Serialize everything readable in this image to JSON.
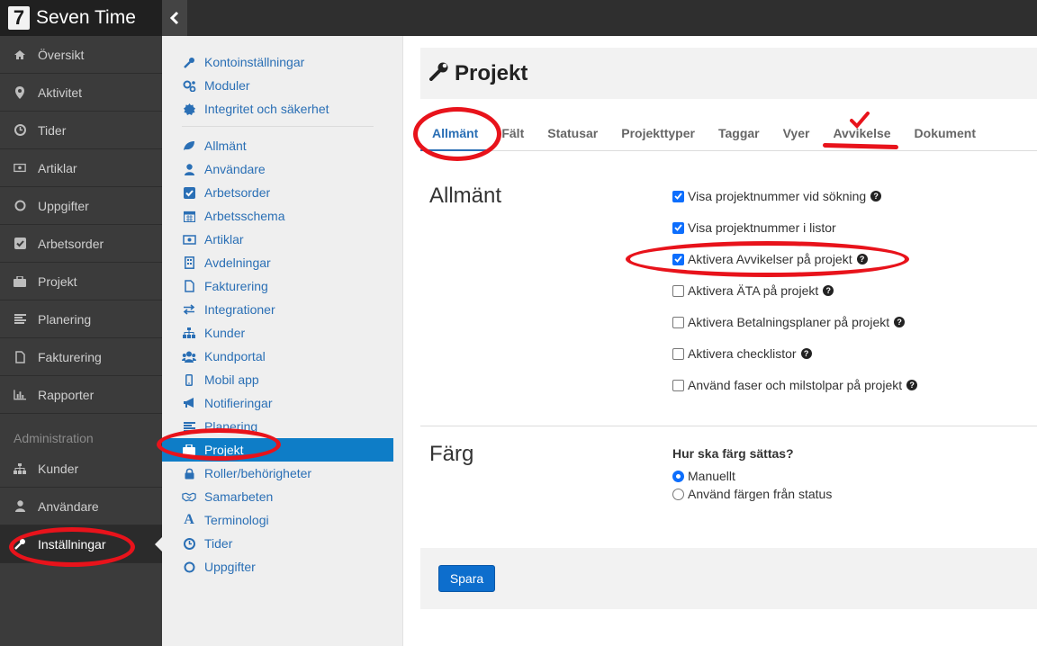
{
  "app": {
    "logo_number": "7",
    "name": "Seven Time"
  },
  "leftnav": {
    "items": [
      {
        "label": "Översikt",
        "icon": "home-icon"
      },
      {
        "label": "Aktivitet",
        "icon": "map-marker-icon"
      },
      {
        "label": "Tider",
        "icon": "clock-icon"
      },
      {
        "label": "Artiklar",
        "icon": "money-icon"
      },
      {
        "label": "Uppgifter",
        "icon": "circle-icon"
      },
      {
        "label": "Arbetsorder",
        "icon": "check-square-icon"
      },
      {
        "label": "Projekt",
        "icon": "briefcase-icon"
      },
      {
        "label": "Planering",
        "icon": "list-icon"
      },
      {
        "label": "Fakturering",
        "icon": "file-icon"
      },
      {
        "label": "Rapporter",
        "icon": "bar-chart-icon"
      }
    ],
    "section_label": "Administration",
    "admin_items": [
      {
        "label": "Kunder",
        "icon": "sitemap-icon"
      },
      {
        "label": "Användare",
        "icon": "user-icon"
      },
      {
        "label": "Inställningar",
        "icon": "wrench-icon"
      }
    ]
  },
  "submenu": {
    "top_items": [
      {
        "label": "Kontoinställningar",
        "icon": "wrench-icon"
      },
      {
        "label": "Moduler",
        "icon": "cogs-icon"
      },
      {
        "label": "Integritet och säkerhet",
        "icon": "certificate-icon"
      }
    ],
    "items": [
      {
        "label": "Allmänt",
        "icon": "leaf-icon"
      },
      {
        "label": "Användare",
        "icon": "user-icon"
      },
      {
        "label": "Arbetsorder",
        "icon": "check-square-icon"
      },
      {
        "label": "Arbetsschema",
        "icon": "calendar-icon"
      },
      {
        "label": "Artiklar",
        "icon": "money-icon"
      },
      {
        "label": "Avdelningar",
        "icon": "building-icon"
      },
      {
        "label": "Fakturering",
        "icon": "file-icon"
      },
      {
        "label": "Integrationer",
        "icon": "exchange-icon"
      },
      {
        "label": "Kunder",
        "icon": "sitemap-icon"
      },
      {
        "label": "Kundportal",
        "icon": "users-icon"
      },
      {
        "label": "Mobil app",
        "icon": "mobile-icon"
      },
      {
        "label": "Notifieringar",
        "icon": "bullhorn-icon"
      },
      {
        "label": "Planering",
        "icon": "list-icon"
      },
      {
        "label": "Projekt",
        "icon": "briefcase-icon"
      },
      {
        "label": "Roller/behörigheter",
        "icon": "lock-icon"
      },
      {
        "label": "Samarbeten",
        "icon": "handshake-icon"
      },
      {
        "label": "Terminologi",
        "icon": "font-icon"
      },
      {
        "label": "Tider",
        "icon": "clock-icon"
      },
      {
        "label": "Uppgifter",
        "icon": "circle-icon"
      }
    ]
  },
  "page": {
    "title": "Projekt",
    "title_icon": "wrench-icon"
  },
  "tabs": [
    "Allmänt",
    "Fält",
    "Statusar",
    "Projekttyper",
    "Taggar",
    "Vyer",
    "Avvikelse",
    "Dokument"
  ],
  "general": {
    "title": "Allmänt",
    "options": [
      {
        "label": "Visa projektnummer vid sökning",
        "checked": true,
        "help": true
      },
      {
        "label": "Visa projektnummer i listor",
        "checked": true,
        "help": false
      },
      {
        "label": "Aktivera Avvikelser på projekt",
        "checked": true,
        "help": true
      },
      {
        "label": "Aktivera ÄTA på projekt",
        "checked": false,
        "help": true
      },
      {
        "label": "Aktivera Betalningsplaner på projekt",
        "checked": false,
        "help": true
      },
      {
        "label": "Aktivera checklistor",
        "checked": false,
        "help": true
      },
      {
        "label": "Använd faser och milstolpar på projekt",
        "checked": false,
        "help": true
      }
    ]
  },
  "color": {
    "title": "Färg",
    "question": "Hur ska färg sättas?",
    "options": [
      {
        "label": "Manuellt",
        "selected": true
      },
      {
        "label": "Använd färgen från status",
        "selected": false
      }
    ]
  },
  "footer": {
    "save_label": "Spara"
  },
  "colors": {
    "accent": "#0e7dc7",
    "annotation": "#e8131b",
    "link": "#2a6fb5"
  }
}
